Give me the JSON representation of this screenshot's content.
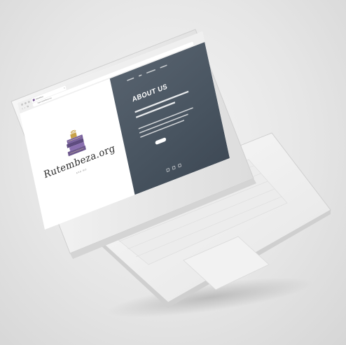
{
  "browser": {
    "tab_title": "Rutembeza",
    "tab_close": "×",
    "address": "https://rutembeza.org",
    "nav_arrows": "‹ › ↻"
  },
  "site": {
    "logo_text": "Rutembeza.org",
    "logo_subtitle": "AND MO",
    "hero_title": "ABOUT US"
  },
  "colors": {
    "right_pane": "#4b5661",
    "book_purple": "#6f5a8f",
    "book_gold": "#c8a24a"
  }
}
